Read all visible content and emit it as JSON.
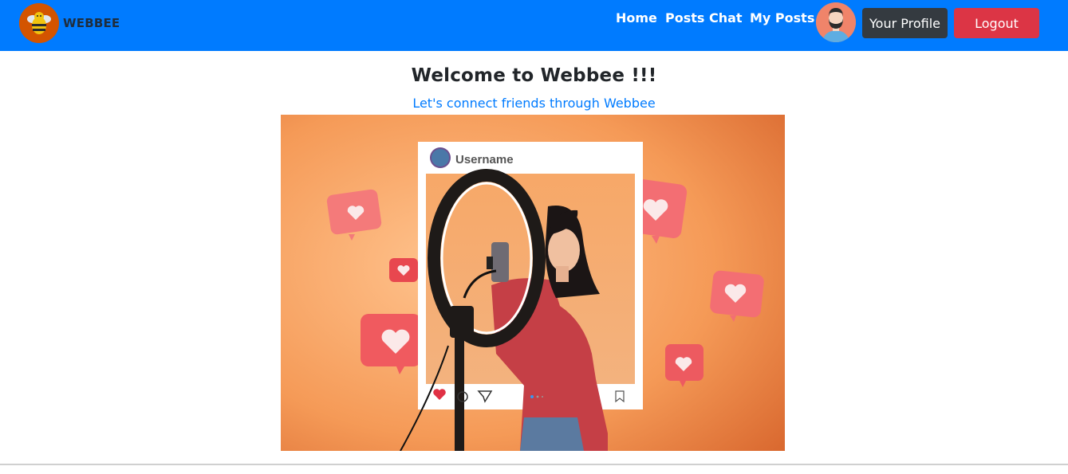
{
  "navbar": {
    "brand": "WEBBEE",
    "links": [
      {
        "label": "Home"
      },
      {
        "label": "Posts"
      },
      {
        "label": "Chat"
      },
      {
        "label": "My Posts"
      }
    ],
    "profile_button": "Your Profile",
    "logout_button": "Logout",
    "colors": {
      "bar": "#007bff",
      "profile": "#343a40",
      "logout": "#dc3545"
    }
  },
  "main": {
    "welcome": "Welcome to Webbee !!!",
    "subtitle": "Let's connect friends through Webbee",
    "hero": {
      "post_username": "Username",
      "icons": [
        "heart-icon",
        "comment-icon",
        "share-icon",
        "bookmark-icon"
      ]
    }
  }
}
